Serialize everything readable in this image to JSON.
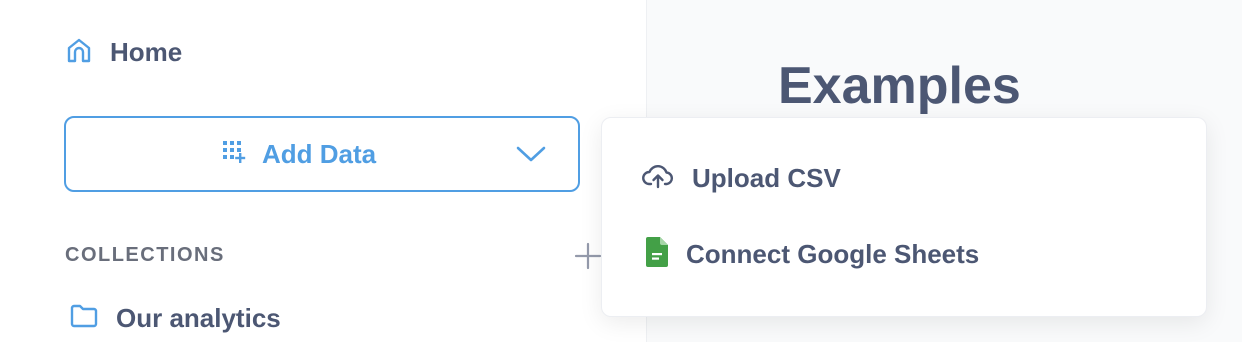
{
  "sidebar": {
    "home_label": "Home",
    "add_data_label": "Add Data",
    "collections_heading": "COLLECTIONS",
    "collections": [
      {
        "label": "Our analytics"
      }
    ]
  },
  "main": {
    "title": "Examples"
  },
  "add_data_menu": {
    "items": [
      {
        "label": "Upload CSV",
        "icon": "cloud-upload-icon"
      },
      {
        "label": "Connect Google Sheets",
        "icon": "google-sheets-icon"
      }
    ]
  },
  "colors": {
    "brand": "#509ee3",
    "text": "#4c5773",
    "muted": "#696e7b",
    "sheets_green": "#43a047"
  }
}
